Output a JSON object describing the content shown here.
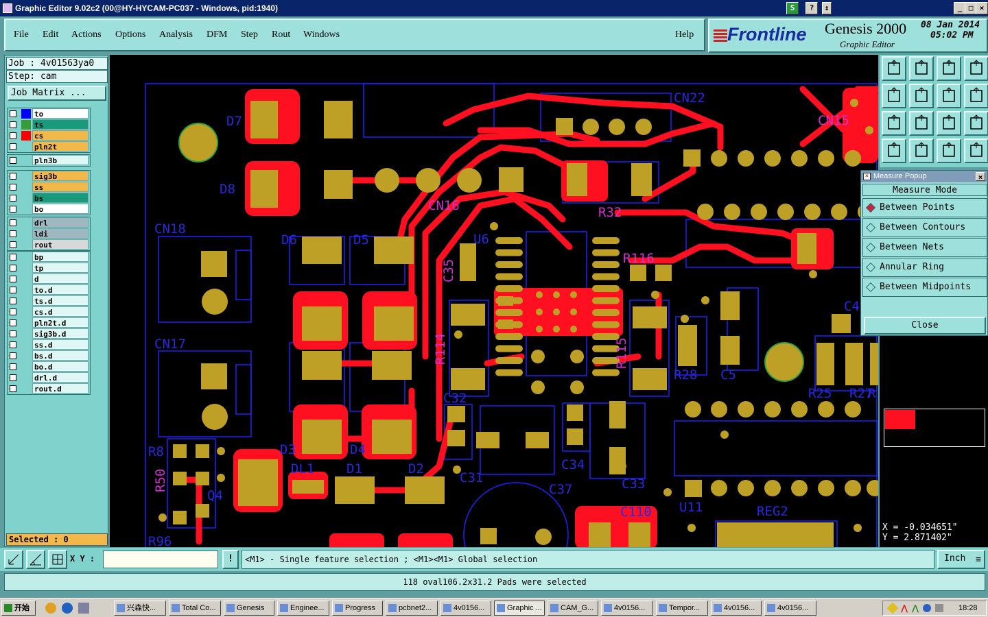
{
  "window": {
    "title": "Graphic Editor 9.02c2 (00@HY-HYCAM-PC037 - Windows, pid:1940)"
  },
  "menu": {
    "items": [
      "File",
      "Edit",
      "Actions",
      "Options",
      "Analysis",
      "DFM",
      "Step",
      "Rout",
      "Windows"
    ],
    "help": "Help"
  },
  "brand": {
    "logo": "Frontline",
    "product": "Genesis 2000",
    "subtitle": "Graphic Editor",
    "date": "08 Jan 2014",
    "time": "05:02 PM"
  },
  "job": {
    "job_label": "Job : 4v01563ya0",
    "step_label": "Step: cam",
    "matrix_button": "Job Matrix ..."
  },
  "layer_groups": [
    [
      {
        "name": "to",
        "color": "#ffffff",
        "swatch": "#0000ff"
      },
      {
        "name": "ts",
        "color": "#1a9a7a",
        "swatch": "#3a9a3a"
      },
      {
        "name": "cs",
        "color": "#f2b84a",
        "swatch": "#ff0000"
      },
      {
        "name": "pln2t",
        "color": "#f2b84a",
        "swatch": "#7fd3cc"
      }
    ],
    [
      {
        "name": "pln3b",
        "color": "#dff8f5",
        "swatch": "#7fd3cc"
      }
    ],
    [
      {
        "name": "sig3b",
        "color": "#f2b84a",
        "swatch": "#7fd3cc"
      },
      {
        "name": "ss",
        "color": "#f2b84a",
        "swatch": "#7fd3cc"
      },
      {
        "name": "bs",
        "color": "#1a9a7a",
        "swatch": "#7fd3cc"
      },
      {
        "name": "bo",
        "color": "#ffffff",
        "swatch": "#7fd3cc"
      }
    ],
    [
      {
        "name": "drl",
        "color": "#9fb8c0",
        "swatch": "#7fd3cc"
      },
      {
        "name": "ldi",
        "color": "#9fb8c0",
        "swatch": "#7fd3cc"
      },
      {
        "name": "rout",
        "color": "#d8d8d8",
        "swatch": "#7fd3cc"
      }
    ],
    [
      {
        "name": "bp",
        "color": "#dff8f5",
        "swatch": "#7fd3cc"
      },
      {
        "name": "tp",
        "color": "#dff8f5",
        "swatch": "#7fd3cc"
      },
      {
        "name": "d",
        "color": "#dff8f5",
        "swatch": "#7fd3cc"
      },
      {
        "name": "to.d",
        "color": "#dff8f5",
        "swatch": "#7fd3cc"
      },
      {
        "name": "ts.d",
        "color": "#dff8f5",
        "swatch": "#7fd3cc"
      },
      {
        "name": "cs.d",
        "color": "#dff8f5",
        "swatch": "#7fd3cc"
      },
      {
        "name": "pln2t.d",
        "color": "#dff8f5",
        "swatch": "#7fd3cc"
      },
      {
        "name": "sig3b.d",
        "color": "#dff8f5",
        "swatch": "#7fd3cc"
      },
      {
        "name": "ss.d",
        "color": "#dff8f5",
        "swatch": "#7fd3cc"
      },
      {
        "name": "bs.d",
        "color": "#dff8f5",
        "swatch": "#7fd3cc"
      },
      {
        "name": "bo.d",
        "color": "#dff8f5",
        "swatch": "#7fd3cc"
      },
      {
        "name": "drl.d",
        "color": "#dff8f5",
        "swatch": "#7fd3cc"
      },
      {
        "name": "rout.d",
        "color": "#dff8f5",
        "swatch": "#7fd3cc"
      }
    ]
  ],
  "selected_label": "Selected : 0",
  "pcb_labels": [
    "D7",
    "D8",
    "CN22",
    "CN15",
    "CN16",
    "R32",
    "CN18",
    "D6",
    "D5",
    "U6",
    "C35",
    "R116",
    "CN17",
    "R114",
    "R115",
    "R28",
    "C5",
    "R25",
    "R27",
    "R",
    "C32",
    "R8",
    "R50",
    "Q4",
    "D3",
    "D4",
    "DL1",
    "D1",
    "D2",
    "C31",
    "C34",
    "C33",
    "C37",
    "C110",
    "U11",
    "REG2",
    "R96",
    "C4"
  ],
  "measure": {
    "title": "Measure Popup",
    "mode_label": "Measure Mode",
    "options": [
      "Between Points",
      "Between Contours",
      "Between Nets",
      "Annular Ring",
      "Between Midpoints"
    ],
    "selected": "Between Points",
    "close": "Close"
  },
  "coords": {
    "x": "X = -0.034651\"",
    "y": "Y = 2.871402\""
  },
  "bottom": {
    "xy_label": "X Y :",
    "xy_value": "",
    "hint": "<M1> - Single feature selection ; <M1><M1> Global selection",
    "unit": "Inch"
  },
  "status": "118 oval106.2x31.2 Pads were selected",
  "taskbar": {
    "start": "开始",
    "items": [
      "兴森快...",
      "Total Co...",
      "Genesis",
      "Enginee...",
      "Progress",
      "pcbnet2...",
      "4v0156...",
      "Graphic ...",
      "CAM_G...",
      "4v0156...",
      "Tempor...",
      "4v0156...",
      "4v0156..."
    ],
    "clock": "18:28"
  },
  "colors": {
    "trace": "#ff1020",
    "pad": "#bfa026",
    "outline": "#2020ff",
    "label": "#2828e0",
    "panel": "#7fd3cc"
  }
}
